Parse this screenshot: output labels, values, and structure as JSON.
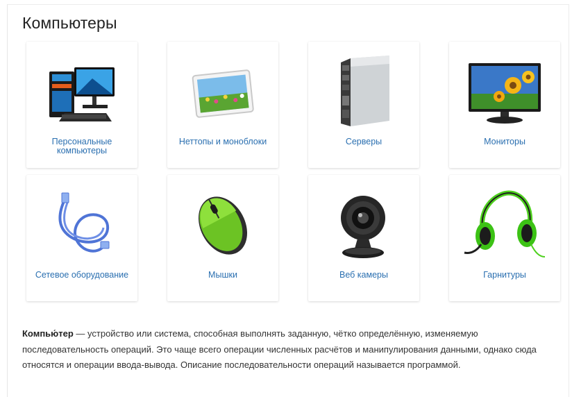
{
  "page": {
    "title": "Компьютеры"
  },
  "categories": [
    {
      "label": "Персональные компьютеры",
      "icon": "desktop-pc-icon"
    },
    {
      "label": "Неттопы и моноблоки",
      "icon": "tablet-icon"
    },
    {
      "label": "Серверы",
      "icon": "blade-server-icon"
    },
    {
      "label": "Мониторы",
      "icon": "monitor-icon"
    },
    {
      "label": "Сетевое оборудование",
      "icon": "network-cable-icon"
    },
    {
      "label": "Мышки",
      "icon": "mouse-icon"
    },
    {
      "label": "Веб камеры",
      "icon": "webcam-icon"
    },
    {
      "label": "Гарнитуры",
      "icon": "headset-icon"
    }
  ],
  "description": {
    "term": "Компью́тер",
    "text": " — устройство или система, способная выполнять заданную, чётко определённую, изменяемую последовательность операций. Это чаще всего операции численных расчётов и манипулирования данными, однако сюда относятся и операции ввода-вывода. Описание последовательности операций называется программой."
  },
  "colors": {
    "link": "#2a6fb0",
    "card_bg": "#ffffff",
    "text": "#333333"
  }
}
